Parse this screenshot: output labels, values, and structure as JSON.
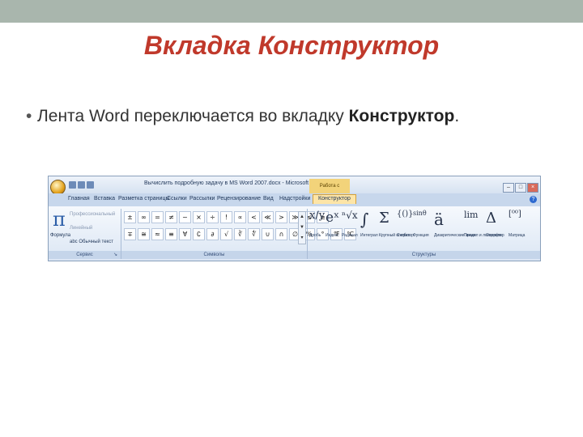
{
  "slide": {
    "title": "Вкладка Конструктор",
    "bullet_prefix": "Лента Word переключается во вкладку ",
    "bullet_bold": "Конструктор",
    "bullet_suffix": "."
  },
  "word": {
    "doc_title": "Вычислить подробную задачу в MS Word 2007.docx - Microsoft Word",
    "context_title": "Работа с формулами",
    "tabs": [
      "Главная",
      "Вставка",
      "Разметка страницы",
      "Ссылки",
      "Рассылки",
      "Рецензирование",
      "Вид",
      "Надстройки",
      "Конструктор"
    ],
    "active_tab": "Конструктор",
    "groups": {
      "service": "Сервис",
      "symbols": "Символы",
      "structures": "Структуры"
    },
    "formula_label": "Формула",
    "formula_icon": "π",
    "options": [
      "Профессиональный",
      "Линейный",
      "abc Обычный текст"
    ],
    "symbols_row1": [
      "±",
      "∞",
      "=",
      "≠",
      "~",
      "×",
      "÷",
      "!",
      "∝",
      "<",
      "≪",
      ">",
      "≫",
      "≤",
      "≥"
    ],
    "symbols_row2": [
      "∓",
      "≅",
      "≈",
      "≡",
      "∀",
      "∁",
      "∂",
      "√",
      "∛",
      "∜",
      "∪",
      "∩",
      "∅",
      "%",
      "°",
      "℉",
      "℃"
    ],
    "structures": [
      {
        "icon": "x/y",
        "label": "Дробь"
      },
      {
        "icon": "eˣ",
        "label": "Индекс"
      },
      {
        "icon": "ⁿ√x",
        "label": "Радикал"
      },
      {
        "icon": "∫",
        "label": "Интеграл"
      },
      {
        "icon": "Σ",
        "label": "Крупный оператор"
      },
      {
        "icon": "{()}",
        "label": "Скобка"
      },
      {
        "icon": "sinθ",
        "label": "Функция"
      },
      {
        "icon": "ä",
        "label": "Диакритические знаки"
      },
      {
        "icon": "lim",
        "label": "Предел и логарифм"
      },
      {
        "icon": "Δ",
        "label": "Оператор"
      },
      {
        "icon": "[⁰⁰]",
        "label": "Матрица"
      }
    ]
  },
  "colors": {
    "title": "#c0392b",
    "topbar": "#a9b6ad",
    "ribbon": "#dbe6f4",
    "active_tab": "#fde5a7"
  }
}
